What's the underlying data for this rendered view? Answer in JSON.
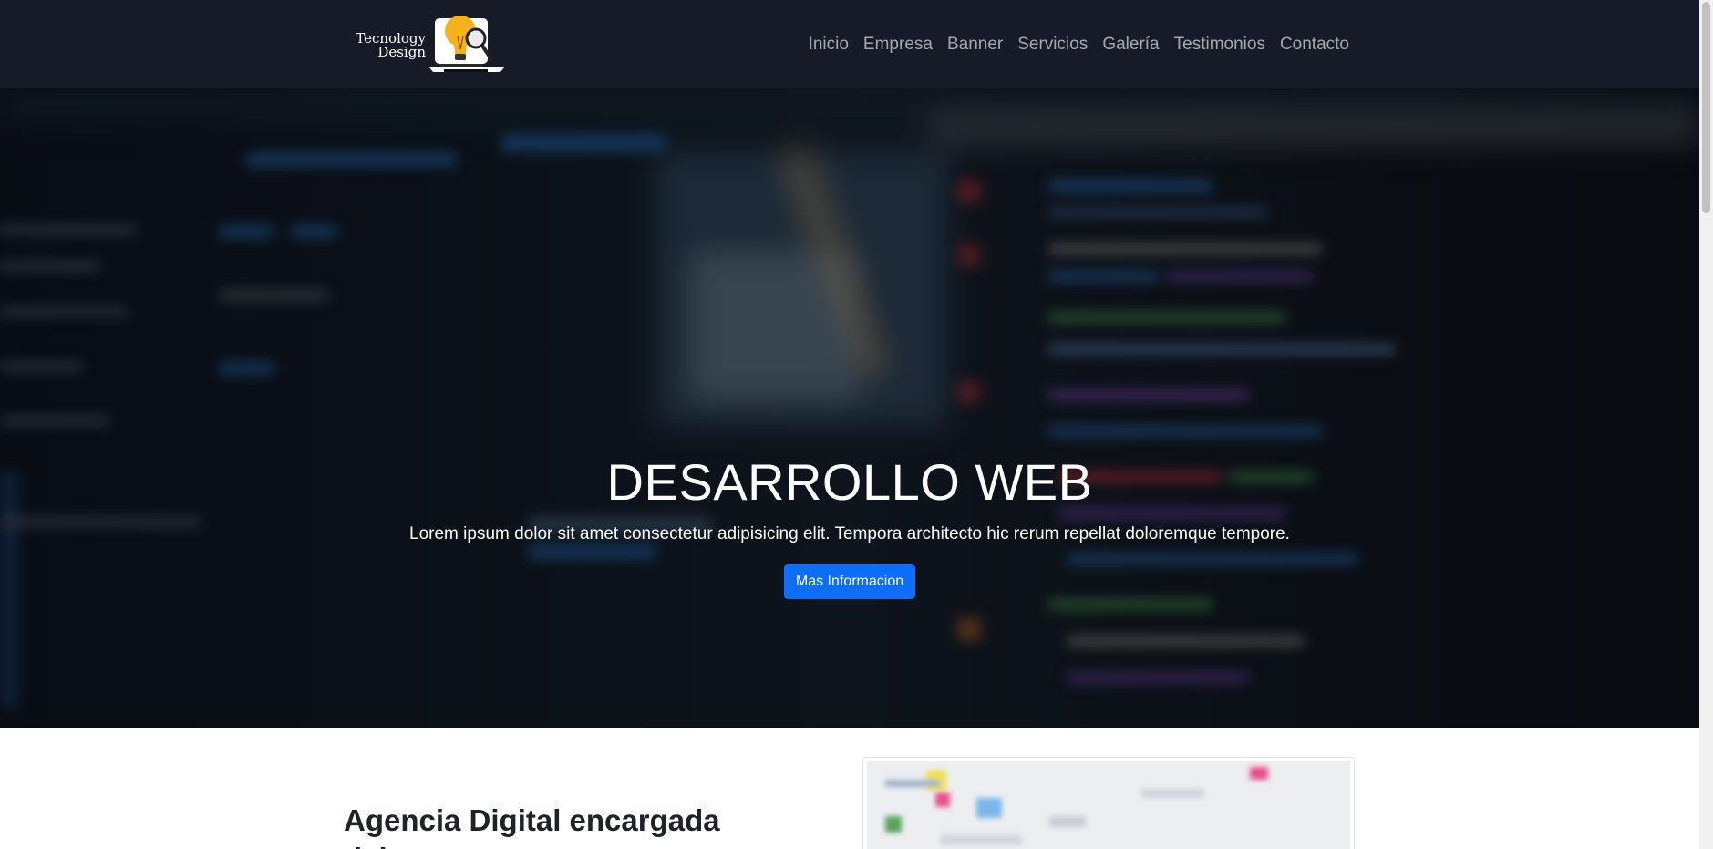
{
  "brand": {
    "line1": "Tecnology",
    "line2": "Design",
    "logo_icon": "lightbulb-magnifier-laptop-icon"
  },
  "nav": {
    "items": [
      {
        "label": "Inicio"
      },
      {
        "label": "Empresa"
      },
      {
        "label": "Banner"
      },
      {
        "label": "Servicios"
      },
      {
        "label": "Galería"
      },
      {
        "label": "Testimonios"
      },
      {
        "label": "Contacto"
      }
    ]
  },
  "hero": {
    "title": "DESARROLLO WEB",
    "subtitle": "Lorem ipsum dolor sit amet consectetur adipisicing elit. Tempora architecto hic rerum repellat doloremque tempore.",
    "button_label": "Mas Informacion"
  },
  "about": {
    "title": "Agencia Digital encargada del"
  },
  "colors": {
    "navbar_bg": "#161b27",
    "button_primary": "#0d6efd",
    "logo_accent": "#f5b21a"
  }
}
